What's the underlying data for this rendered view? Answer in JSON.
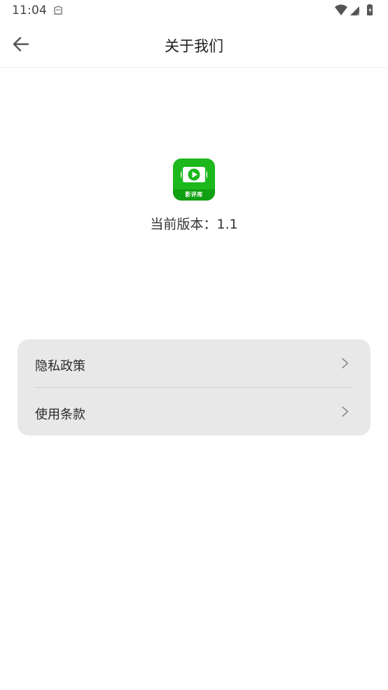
{
  "status_bar": {
    "time": "11:04"
  },
  "header": {
    "title": "关于我们",
    "back_icon": "arrow-left-icon"
  },
  "app": {
    "icon_label": "影评库",
    "version_text": "当前版本：1.1",
    "brand_color": "#1cb81c"
  },
  "menu": {
    "items": [
      {
        "label": "隐私政策",
        "icon": "chevron-right-icon"
      },
      {
        "label": "使用条款",
        "icon": "chevron-right-icon"
      }
    ]
  }
}
